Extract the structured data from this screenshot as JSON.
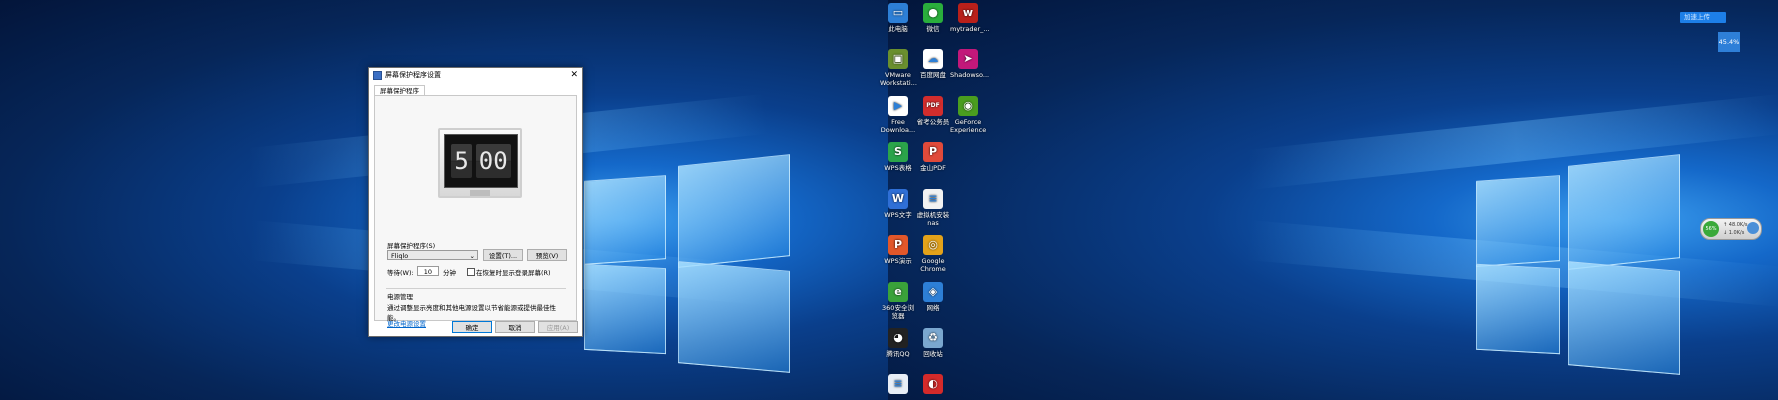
{
  "dialog": {
    "title": "屏幕保护程序设置",
    "tab": "屏幕保护程序",
    "preview_digits": [
      "5",
      "00"
    ],
    "screensaver_label": "屏幕保护程序(S)",
    "screensaver_value": "Fliqlo",
    "settings_button": "设置(T)...",
    "preview_button": "预览(V)",
    "wait_label": "等待(W):",
    "wait_value": "10",
    "wait_unit": "分钟",
    "resume_checkbox": "在恢复时显示登录屏幕(R)",
    "power_title": "电源管理",
    "power_desc": "通过调整显示亮度和其他电源设置以节省能源或提供最佳性能。",
    "power_link": "更改电源设置",
    "ok_button": "确定",
    "cancel_button": "取消",
    "apply_button": "应用(A)"
  },
  "desktop_icons": [
    {
      "label": "此电脑",
      "icon": "computer-icon",
      "color": "#2d7fd6",
      "glyph": "▭"
    },
    {
      "label": "微信",
      "icon": "wechat-icon",
      "color": "#2aae3c",
      "glyph": "●"
    },
    {
      "label": "mytrader_...",
      "icon": "mytrader-icon",
      "color": "#b8201a",
      "glyph": "w"
    },
    {
      "label": "VMware Workstati...",
      "icon": "vmware-icon",
      "color": "#6a8f2e",
      "glyph": "▣"
    },
    {
      "label": "百度网盘",
      "icon": "baidu-netdisk-icon",
      "color": "#ffffff",
      "glyph": "☁"
    },
    {
      "label": "Shadowso...",
      "icon": "shadowsocks-icon",
      "color": "#c2187a",
      "glyph": "➤"
    },
    {
      "label": "Free Downloa...",
      "icon": "free-download-icon",
      "color": "#ffffff",
      "glyph": "▶"
    },
    {
      "label": "省考公务员",
      "icon": "pdf-icon",
      "color": "#d22d2d",
      "glyph": "PDF"
    },
    {
      "label": "GeForce Experience",
      "icon": "geforce-icon",
      "color": "#4a9d1f",
      "glyph": "◉"
    },
    {
      "label": "WPS表格",
      "icon": "wps-sheet-icon",
      "color": "#2ba44a",
      "glyph": "S"
    },
    {
      "label": "金山PDF",
      "icon": "kingsoft-pdf-icon",
      "color": "#e04a3a",
      "glyph": "P"
    },
    {
      "label": "WPS文字",
      "icon": "wps-writer-icon",
      "color": "#2f6fd6",
      "glyph": "W"
    },
    {
      "label": "虚拟机安装 nas",
      "icon": "document-icon",
      "color": "#f2f2f2",
      "glyph": "≡"
    },
    {
      "label": "WPS演示",
      "icon": "wps-presentation-icon",
      "color": "#e2572a",
      "glyph": "P"
    },
    {
      "label": "Google Chrome",
      "icon": "chrome-icon",
      "color": "#e3a21a",
      "glyph": "◎"
    },
    {
      "label": "360安全浏览器",
      "icon": "360-browser-icon",
      "color": "#3aa23a",
      "glyph": "e"
    },
    {
      "label": "网络",
      "icon": "network-icon",
      "color": "#2d7fd6",
      "glyph": "◈"
    },
    {
      "label": "腾讯QQ",
      "icon": "qq-icon",
      "color": "#222222",
      "glyph": "◕"
    },
    {
      "label": "回收站",
      "icon": "recycle-bin-icon",
      "color": "#7aa7cf",
      "glyph": "♻"
    },
    {
      "label": "",
      "icon": "document-icon",
      "color": "#e8eef6",
      "glyph": "≡"
    },
    {
      "label": "",
      "icon": "netease-music-icon",
      "color": "#d42a2a",
      "glyph": "◐"
    }
  ],
  "tray": {
    "upload_badge": "加速上传",
    "percent_box": "45.4%",
    "net_percent": "56%",
    "up_speed": "↑ 48.0K/s",
    "down_speed": "↓ 1.0K/s"
  }
}
